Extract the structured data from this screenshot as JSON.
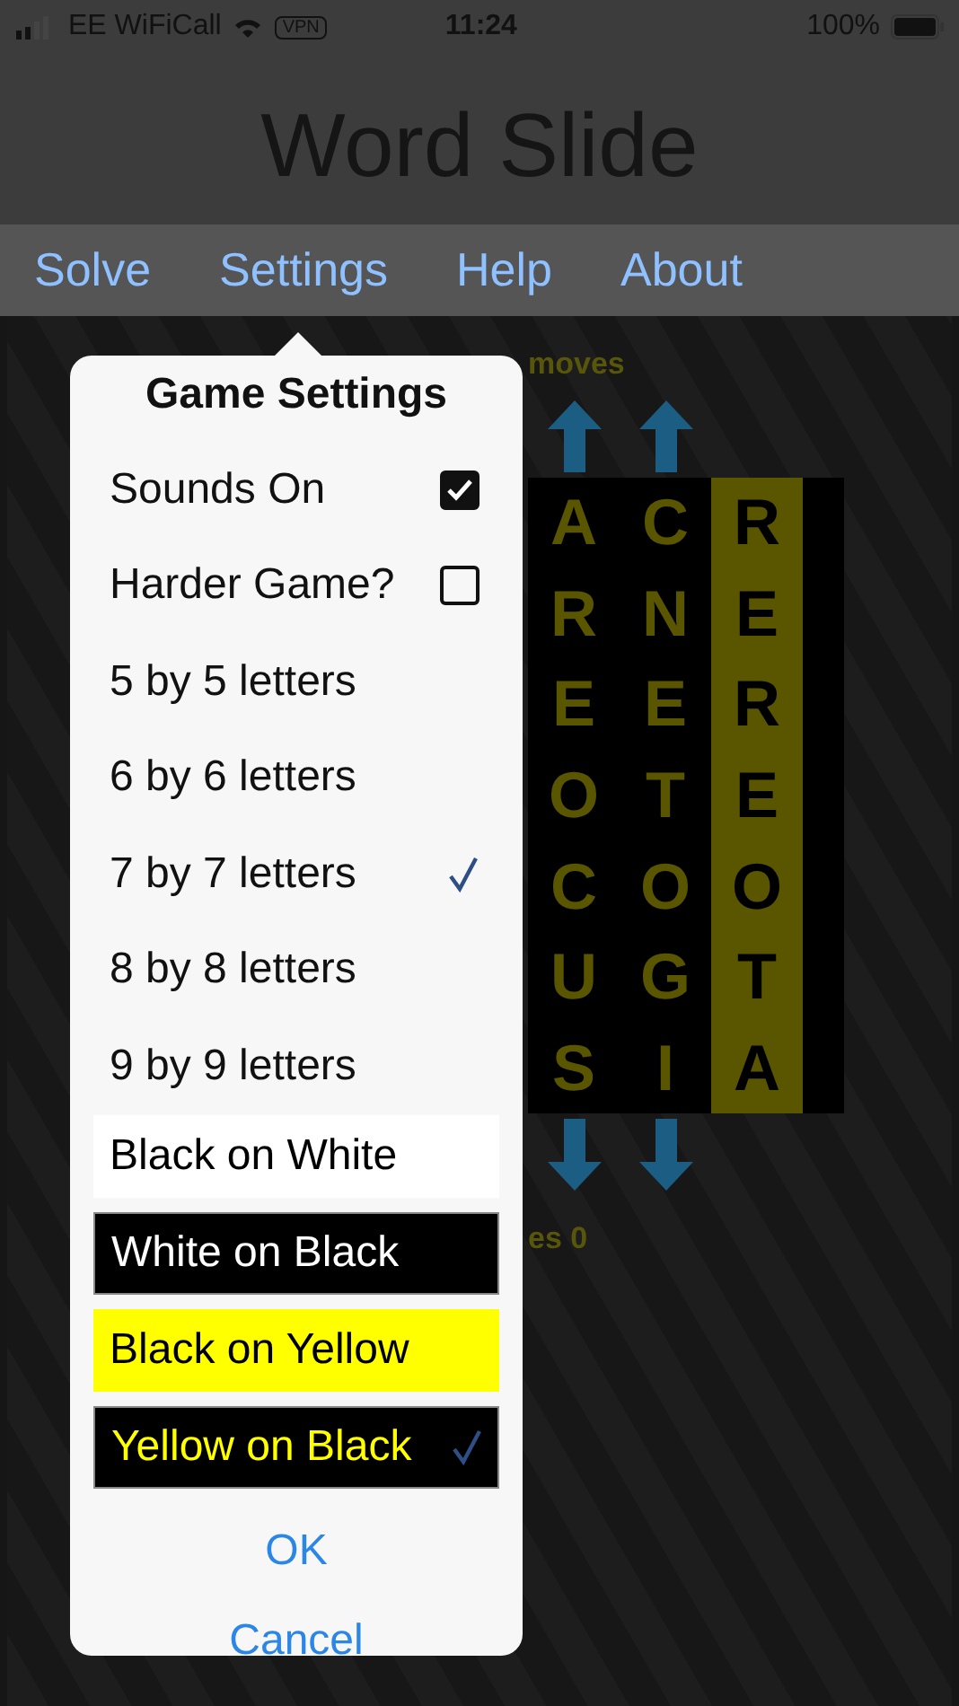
{
  "status_bar": {
    "carrier": "EE WiFiCall",
    "vpn": "VPN",
    "time": "11:24",
    "battery": "100%"
  },
  "title": "Word Slide",
  "menu": [
    {
      "label": "Solve"
    },
    {
      "label": "Settings"
    },
    {
      "label": "Help"
    },
    {
      "label": "About"
    }
  ],
  "game": {
    "top_text": "moves",
    "bottom_text": "es 0",
    "columns": [
      {
        "letters": [
          "A",
          "R",
          "E",
          "O",
          "C",
          "U",
          "S"
        ],
        "highlighted": false,
        "arrows": true
      },
      {
        "letters": [
          "C",
          "N",
          "E",
          "T",
          "O",
          "G",
          "I"
        ],
        "highlighted": false,
        "arrows": true
      },
      {
        "letters": [
          "R",
          "E",
          "R",
          "E",
          "O",
          "T",
          "A"
        ],
        "highlighted": true,
        "arrows": false
      }
    ]
  },
  "settings": {
    "title": "Game Settings",
    "toggles": [
      {
        "label": "Sounds On",
        "checked": true
      },
      {
        "label": "Harder Game?",
        "checked": false
      }
    ],
    "sizes": [
      {
        "label": "5 by 5 letters",
        "selected": false
      },
      {
        "label": "6 by 6 letters",
        "selected": false
      },
      {
        "label": "7 by 7 letters",
        "selected": true
      },
      {
        "label": "8 by 8 letters",
        "selected": false
      },
      {
        "label": "9 by 9 letters",
        "selected": false
      }
    ],
    "themes": [
      {
        "label": "Black on White",
        "kind": "white",
        "selected": false
      },
      {
        "label": "White on Black",
        "kind": "black",
        "selected": false
      },
      {
        "label": "Black on Yellow",
        "kind": "yellow",
        "selected": false
      },
      {
        "label": "Yellow on Black",
        "kind": "yellowblack",
        "selected": true
      }
    ],
    "buttons": [
      "OK",
      "Cancel"
    ]
  }
}
